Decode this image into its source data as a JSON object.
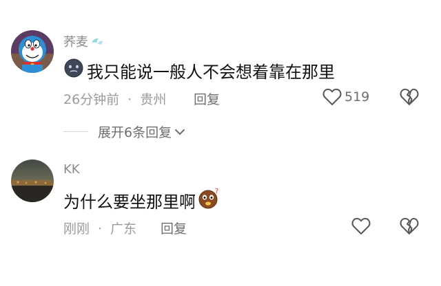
{
  "comments": [
    {
      "username": "荞麦",
      "text": "我只能说一般人不会想着靠在那里",
      "time": "26分钟前",
      "separator": "·",
      "location": "贵州",
      "reply_label": "回复",
      "like_count": "519",
      "expand_replies": "展开6条回复"
    },
    {
      "username": "KK",
      "text": "为什么要坐那里啊",
      "time": "刚刚",
      "separator": "·",
      "location": "广东",
      "reply_label": "回复"
    }
  ],
  "icons": {
    "verified_badge": "sparkle-badge-icon",
    "like": "heart-outline-icon",
    "dislike": "broken-heart-icon",
    "expand": "chevron-down-icon",
    "emoji_1": "dark-face-emoji-icon",
    "emoji_2": "confused-face-emoji-icon"
  },
  "colors": {
    "username": "#8a8a8a",
    "text": "#111111",
    "meta": "#9a9a9a",
    "action": "#6e6e6e"
  }
}
